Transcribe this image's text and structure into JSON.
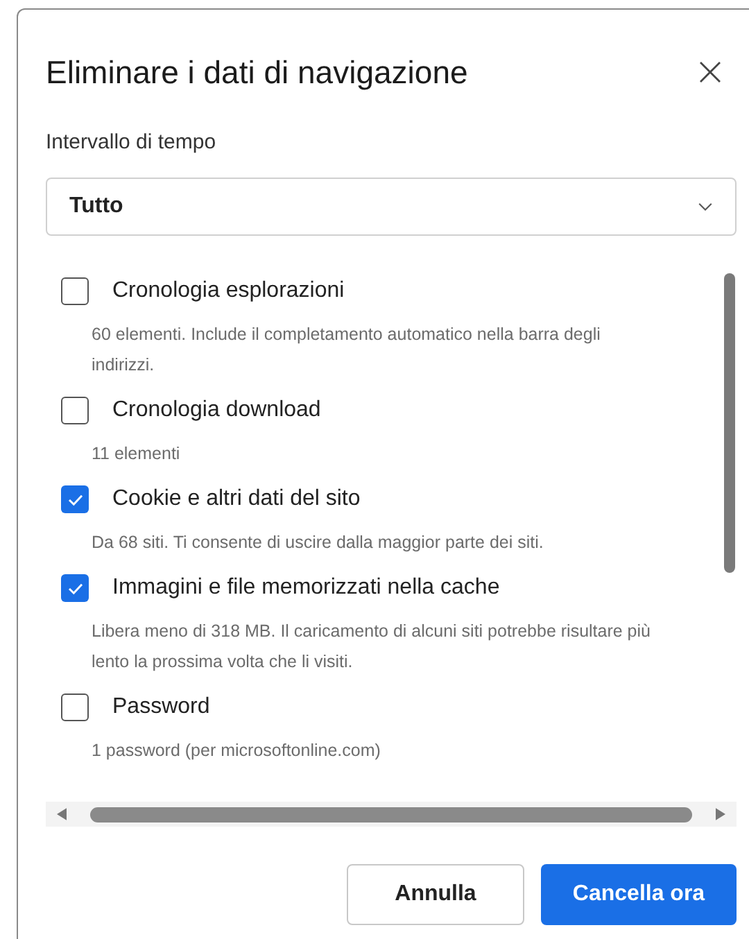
{
  "dialog": {
    "title": "Eliminare i dati di navigazione",
    "time_range": {
      "label": "Intervallo di tempo",
      "value": "Tutto"
    },
    "items": [
      {
        "label": "Cronologia esplorazioni",
        "description": "60 elementi. Include il completamento automatico nella barra degli indirizzi.",
        "checked": false
      },
      {
        "label": "Cronologia download",
        "description": "11 elementi",
        "checked": false
      },
      {
        "label": "Cookie e altri dati del sito",
        "description": "Da 68 siti. Ti consente di uscire dalla maggior parte dei siti.",
        "checked": true
      },
      {
        "label": "Immagini e file memorizzati nella cache",
        "description": "Libera meno di 318 MB. Il caricamento di alcuni siti potrebbe risultare più lento la prossima volta che li visiti.",
        "checked": true
      },
      {
        "label": "Password",
        "description": "1 password (per microsoftonline.com)",
        "checked": false
      }
    ],
    "buttons": [
      {
        "label": "Annulla",
        "kind": "secondary"
      },
      {
        "label": "Cancella ora",
        "kind": "primary"
      }
    ]
  }
}
